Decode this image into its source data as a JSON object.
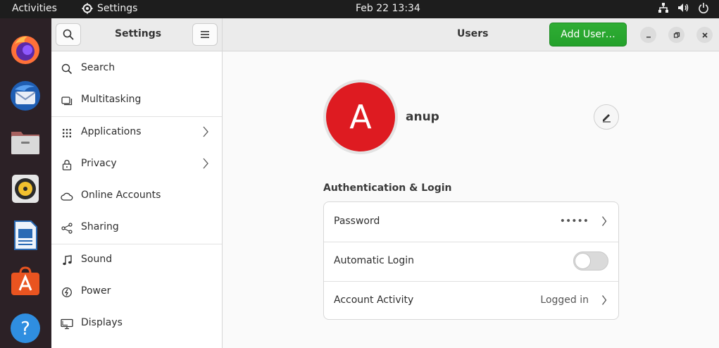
{
  "topbar": {
    "activities": "Activities",
    "app_name": "Settings",
    "clock": "Feb 22  13:34"
  },
  "dock": {
    "items": [
      {
        "name": "firefox-icon"
      },
      {
        "name": "thunderbird-icon"
      },
      {
        "name": "files-icon"
      },
      {
        "name": "rhythmbox-icon"
      },
      {
        "name": "libreoffice-writer-icon"
      },
      {
        "name": "app-center-icon"
      },
      {
        "name": "help-icon"
      }
    ]
  },
  "header": {
    "sidebar_title": "Settings",
    "page_title": "Users",
    "add_user_label": "Add User…"
  },
  "sidebar": {
    "items": [
      {
        "label": "Search",
        "icon": "search-icon"
      },
      {
        "label": "Multitasking",
        "icon": "multitasking-icon"
      },
      {
        "label": "Applications",
        "icon": "applications-icon",
        "has_submenu": true
      },
      {
        "label": "Privacy",
        "icon": "lock-icon",
        "has_submenu": true
      },
      {
        "label": "Online Accounts",
        "icon": "cloud-icon"
      },
      {
        "label": "Sharing",
        "icon": "share-icon"
      },
      {
        "label": "Sound",
        "icon": "music-note-icon"
      },
      {
        "label": "Power",
        "icon": "power-icon"
      },
      {
        "label": "Displays",
        "icon": "display-icon"
      }
    ]
  },
  "user": {
    "avatar_letter": "A",
    "avatar_color": "#de1b21",
    "name": "anup"
  },
  "auth": {
    "section_title": "Authentication & Login",
    "rows": [
      {
        "label": "Password",
        "value": "•••••"
      },
      {
        "label": "Automatic Login",
        "toggle_on": false
      },
      {
        "label": "Account Activity",
        "value": "Logged in"
      }
    ]
  },
  "colors": {
    "accent_green": "#26a269",
    "topbar": "#1d1d1d",
    "dock": "#2c2126"
  }
}
